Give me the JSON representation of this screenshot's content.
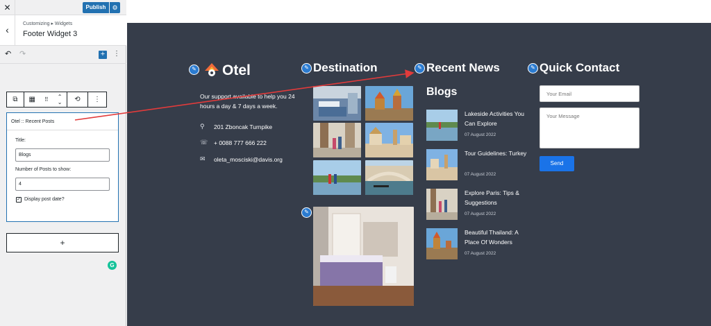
{
  "topbar": {
    "close_icon": "close-icon",
    "publish_label": "Publish",
    "gear_icon": "gear-icon"
  },
  "section": {
    "breadcrumb": "Customizing ▸ Widgets",
    "title": "Footer Widget 3",
    "back_icon": "chevron-left-icon"
  },
  "editor_toolbar": {
    "undo_icon": "undo-icon",
    "redo_icon": "redo-icon",
    "add_label": "+",
    "more_icon": "more-vertical-icon"
  },
  "widget": {
    "name": "Otel :: Recent Posts",
    "title_label": "Title:",
    "title_value": "Blogs",
    "count_label": "Number of Posts to show:",
    "count_value": "4",
    "date_label": "Display post date?",
    "date_checked": true
  },
  "add_widget_label": "+",
  "footer": {
    "logo": "Otel",
    "support": "Our support available to help you 24 hours a day & 7 days a week.",
    "address": "201 Zboncak Turnpike",
    "phone": "+ 0088 777 666 222",
    "email": "oleta_mosciski@davis.org",
    "destination_title": "Destination",
    "recent_title": "Recent News",
    "blogs_heading": "Blogs",
    "posts": [
      {
        "title": "Lakeside Activities You Can Explore",
        "date": "07 August 2022"
      },
      {
        "title": "Tour Guidelines: Turkey",
        "date": "07 August 2022"
      },
      {
        "title": "Explore Paris: Tips & Suggestions",
        "date": "07 August 2022"
      },
      {
        "title": "Beautiful Thailand: A Place Of Wonders",
        "date": "07 August 2022"
      }
    ],
    "quick_title": "Quick Contact",
    "email_placeholder": "Your Email",
    "message_placeholder": "Your Message",
    "send_label": "Send"
  },
  "colors": {
    "accent": "#2271b1",
    "footer_bg": "#363d4a",
    "send": "#1a73e8",
    "arrow": "#e23b3b"
  }
}
